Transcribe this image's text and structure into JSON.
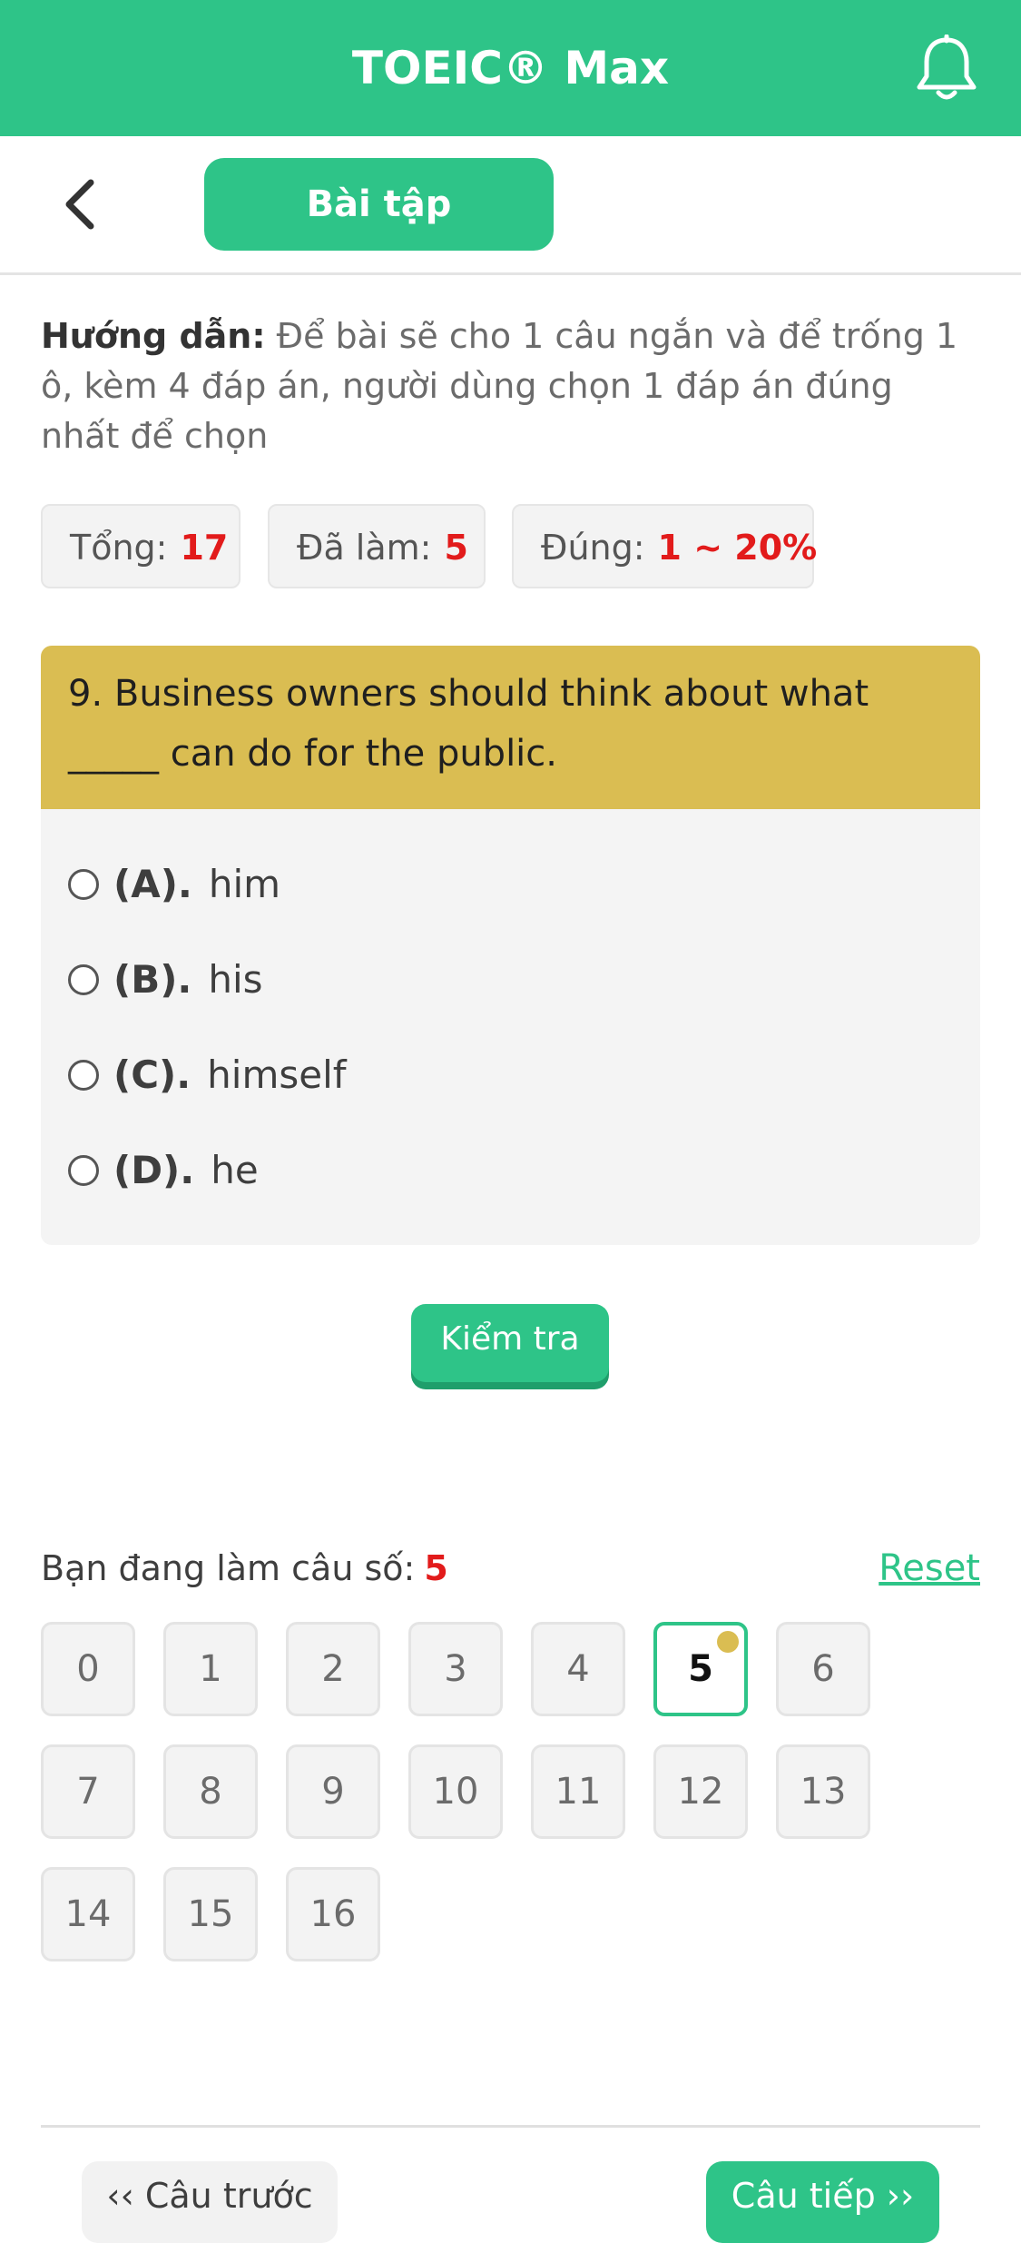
{
  "header": {
    "title": "TOEIC® Max",
    "notification_icon": "bell-icon"
  },
  "toolbar": {
    "back_icon": "chevron-left-icon",
    "tab_label": "Bài tập"
  },
  "instructions": {
    "label": "Hướng dẫn:",
    "text": "Để bài sẽ cho 1 câu ngắn và để trống 1 ô, kèm 4 đáp án, người dùng chọn 1 đáp án đúng nhất để chọn"
  },
  "stats": {
    "total_label": "Tổng:",
    "total_value": "17",
    "done_label": "Đã làm:",
    "done_value": "5",
    "correct_label": "Đúng:",
    "correct_value": "1 ~ 20%"
  },
  "question": {
    "text": "9. Business owners should think about what _____ can do for the public.",
    "options": [
      {
        "letter": "(A).",
        "text": "him"
      },
      {
        "letter": "(B).",
        "text": "his"
      },
      {
        "letter": "(C).",
        "text": "himself"
      },
      {
        "letter": "(D).",
        "text": "he"
      }
    ]
  },
  "check_button": "Kiểm tra",
  "progress": {
    "label": "Bạn đang làm câu số:",
    "current": "5",
    "reset_label": "Reset"
  },
  "question_grid": [
    "0",
    "1",
    "2",
    "3",
    "4",
    "5",
    "6",
    "7",
    "8",
    "9",
    "10",
    "11",
    "12",
    "13",
    "14",
    "15",
    "16"
  ],
  "active_question": "5",
  "navigation": {
    "prev_label": "‹‹ Câu trước",
    "next_label": "Câu tiếp ››"
  },
  "colors": {
    "brand": "#2ec488",
    "question_header": "#dabd52",
    "accent_red": "#e21b1b"
  }
}
